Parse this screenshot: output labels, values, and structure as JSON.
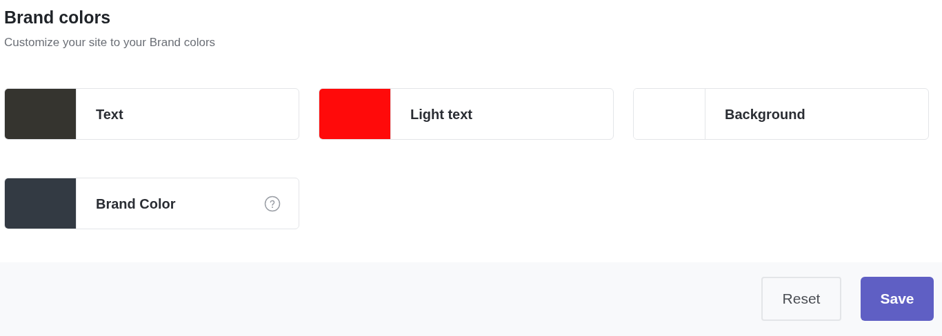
{
  "header": {
    "title": "Brand colors",
    "subtitle": "Customize your site to your Brand colors"
  },
  "colors": [
    {
      "label": "Text",
      "color": "#35342f",
      "help": false
    },
    {
      "label": "Light text",
      "color": "#ff0a0a",
      "help": false
    },
    {
      "label": "Background",
      "color": "#ffffff",
      "help": false
    },
    {
      "label": "Brand Color",
      "color": "#333a43",
      "help": true
    }
  ],
  "buttons": [
    {
      "label": "Reset",
      "kind": "secondary"
    },
    {
      "label": "Save",
      "kind": "primary"
    }
  ]
}
